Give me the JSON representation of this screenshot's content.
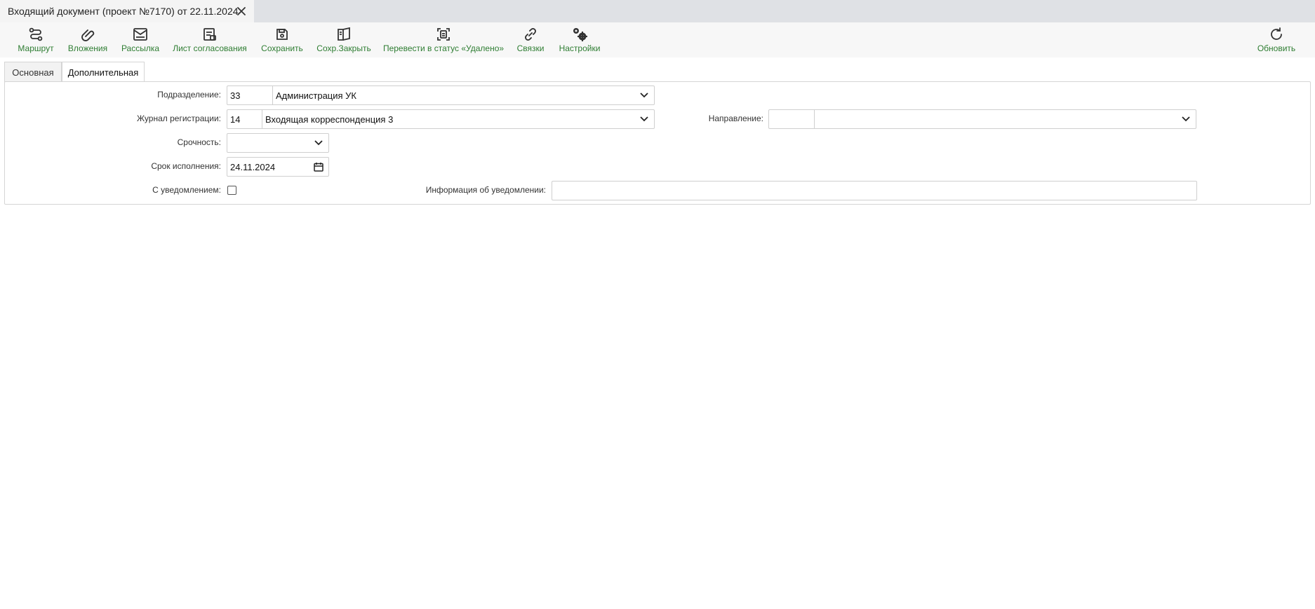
{
  "doc_tab": {
    "title": "Входящий документ (проект №7170) от 22.11.2024"
  },
  "toolbar": {
    "route": "Маршрут",
    "attachments": "Вложения",
    "mailing": "Рассылка",
    "approval_sheet": "Лист согласования",
    "save": "Сохранить",
    "save_close": "Сохр.Закрыть",
    "move_deleted": "Перевести в статус «Удалено»",
    "links": "Связки",
    "settings": "Настройки",
    "refresh": "Обновить"
  },
  "tabs": {
    "main": "Основная",
    "additional": "Дополнительная"
  },
  "form": {
    "department": {
      "label": "Подразделение:",
      "code": "33",
      "name": "Администрация УК"
    },
    "journal": {
      "label": "Журнал регистрации:",
      "code": "14",
      "name": "Входящая корреспонденция 3"
    },
    "direction": {
      "label": "Направление:",
      "code": "",
      "name": ""
    },
    "urgency": {
      "label": "Срочность:",
      "value": ""
    },
    "due_date": {
      "label": "Срок исполнения:",
      "value": "24.11.2024"
    },
    "notify": {
      "label": "С уведомлением:",
      "checked": false
    },
    "notify_info": {
      "label": "Информация об уведомлении:",
      "value": ""
    }
  },
  "colors": {
    "accent": "#2e7d32",
    "tabbar": "#dfe1e5",
    "toolbar": "#f7f7f7"
  },
  "icons": [
    "route-icon",
    "paperclip-icon",
    "mail-icon",
    "document-list-icon",
    "floppy-icon",
    "book-icon",
    "document-frame-icon",
    "link-icon",
    "gears-icon",
    "refresh-icon",
    "close-icon",
    "chevron-down-icon",
    "calendar-icon"
  ]
}
